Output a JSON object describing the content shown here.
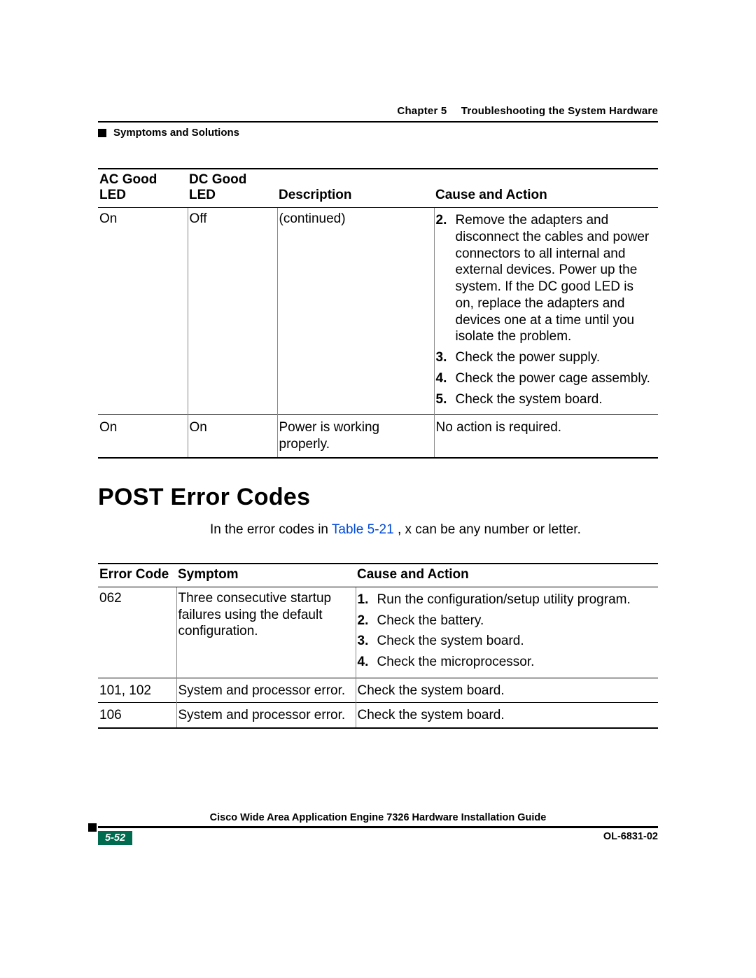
{
  "runhead": {
    "chapter_label": "Chapter 5",
    "chapter_title": "Troubleshooting the System Hardware",
    "section": "Symptoms and Solutions"
  },
  "led_table": {
    "headers": {
      "ac": "AC Good LED",
      "dc": "DC Good LED",
      "desc": "Description",
      "cause": "Cause and Action"
    },
    "row1": {
      "ac": "On",
      "dc": "Off",
      "desc": "(continued)",
      "actions": [
        "Remove the adapters and disconnect the cables and power connectors to all internal and external devices. Power up the system. If the DC good LED is on, replace the adapters and devices one at a time until you isolate the problem.",
        "Check the power supply.",
        "Check the power cage assembly.",
        "Check the system board."
      ],
      "actions_start": 2
    },
    "row2": {
      "ac": "On",
      "dc": "On",
      "desc": "Power is working properly.",
      "cause": "No action is required."
    }
  },
  "post": {
    "heading": "POST Error Codes",
    "intro_pre": "In the error codes in ",
    "intro_xref": "Table 5-21",
    "intro_post": ", x can be any number or letter."
  },
  "err_table": {
    "headers": {
      "code": "Error Code",
      "symptom": "Symptom",
      "cause": "Cause and Action"
    },
    "row1": {
      "code": "062",
      "symptom": "Three consecutive startup failures using the default configuration.",
      "actions": [
        "Run the configuration/setup utility program.",
        "Check the battery.",
        "Check the system board.",
        "Check the microprocessor."
      ]
    },
    "row2": {
      "code": "101, 102",
      "symptom": "System and processor error.",
      "cause": "Check the system board."
    },
    "row3": {
      "code": "106",
      "symptom": "System and processor error.",
      "cause": "Check the system board."
    }
  },
  "footer": {
    "title": "Cisco Wide Area Application Engine 7326 Hardware Installation Guide",
    "pagenum": "5-52",
    "docid": "OL-6831-02"
  }
}
